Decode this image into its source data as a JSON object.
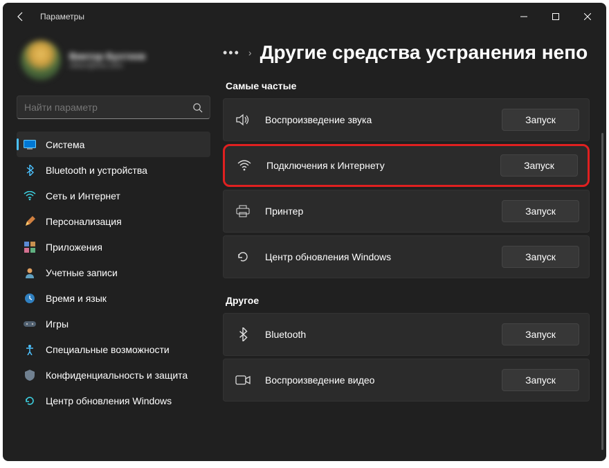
{
  "titlebar": {
    "title": "Параметры"
  },
  "user": {
    "name": "Виктор Бухтеев",
    "email": "viktor@live.com"
  },
  "search": {
    "placeholder": "Найти параметр"
  },
  "sidebar": [
    {
      "id": "system",
      "label": "Система"
    },
    {
      "id": "bluetooth",
      "label": "Bluetooth и устройства"
    },
    {
      "id": "network",
      "label": "Сеть и Интернет"
    },
    {
      "id": "personalization",
      "label": "Персонализация"
    },
    {
      "id": "apps",
      "label": "Приложения"
    },
    {
      "id": "accounts",
      "label": "Учетные записи"
    },
    {
      "id": "time",
      "label": "Время и язык"
    },
    {
      "id": "gaming",
      "label": "Игры"
    },
    {
      "id": "accessibility",
      "label": "Специальные возможности"
    },
    {
      "id": "privacy",
      "label": "Конфиденциальность и защита"
    },
    {
      "id": "update",
      "label": "Центр обновления Windows"
    }
  ],
  "breadcrumb": {
    "more": "•••",
    "title": "Другие средства устранения непо"
  },
  "sections": {
    "frequent": {
      "heading": "Самые частые"
    },
    "other": {
      "heading": "Другое"
    }
  },
  "button_run": "Запуск",
  "troubleshooters": {
    "frequent": [
      {
        "id": "audio",
        "label": "Воспроизведение звука"
      },
      {
        "id": "internet",
        "label": "Подключения к Интернету",
        "highlight": true
      },
      {
        "id": "printer",
        "label": "Принтер"
      },
      {
        "id": "update",
        "label": "Центр обновления Windows"
      }
    ],
    "other": [
      {
        "id": "bluetooth",
        "label": "Bluetooth"
      },
      {
        "id": "video",
        "label": "Воспроизведение видео"
      }
    ]
  }
}
